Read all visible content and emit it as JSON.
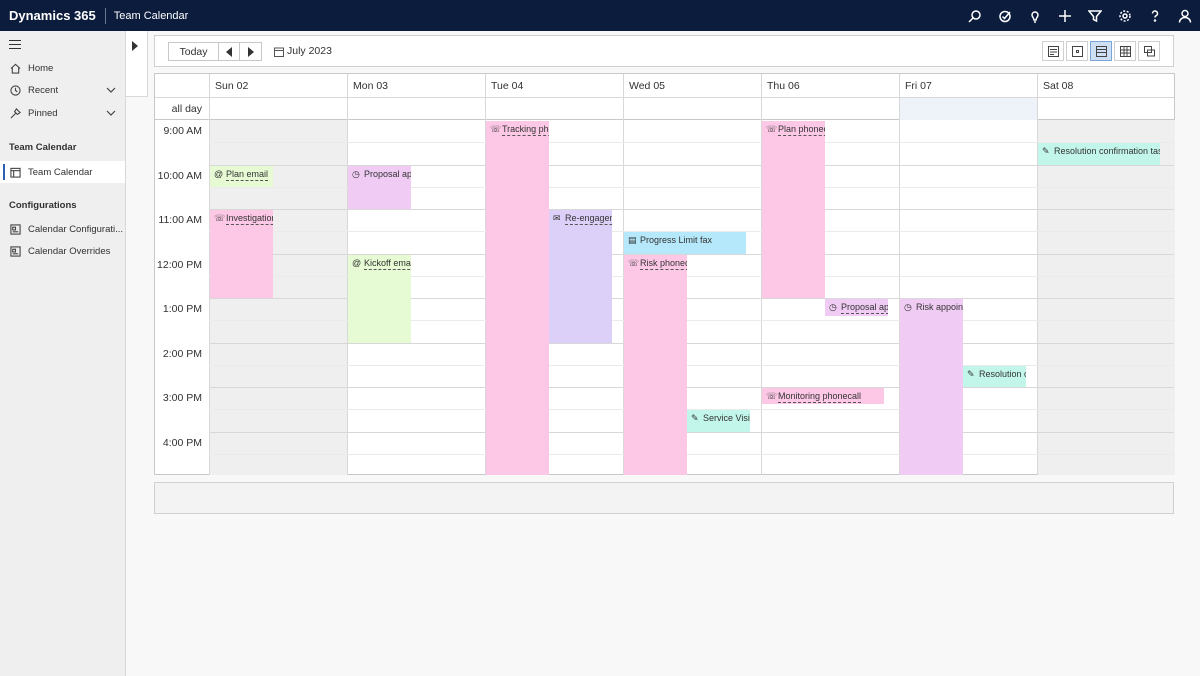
{
  "app": {
    "brand": "Dynamics 365",
    "title": "Team Calendar"
  },
  "topbar_icons": [
    "search-icon",
    "task-icon",
    "lightbulb-icon",
    "plus-icon",
    "filter-icon",
    "gear-icon",
    "help-icon",
    "user-icon"
  ],
  "sidebar": {
    "home": "Home",
    "recent": "Recent",
    "pinned": "Pinned",
    "section1": "Team Calendar",
    "team_calendar": "Team Calendar",
    "section2": "Configurations",
    "calendar_configuration": "Calendar Configurati...",
    "calendar_overrides": "Calendar Overrides"
  },
  "toolbar": {
    "today": "Today",
    "month": "July 2023"
  },
  "calendar": {
    "allday_label": "all day",
    "days": [
      "Sun 02",
      "Mon 03",
      "Tue 04",
      "Wed 05",
      "Thu 06",
      "Fri 07",
      "Sat 08"
    ],
    "times": [
      "9:00 AM",
      "10:00 AM",
      "11:00 AM",
      "12:00 PM",
      "1:00 PM",
      "2:00 PM",
      "3:00 PM",
      "4:00 PM"
    ],
    "events": [
      {
        "title": "Plan email",
        "day": 0,
        "start": 10.0,
        "end": 10.5,
        "sub": 0,
        "subs": 2,
        "color": "green",
        "icon": "@",
        "dashed": true
      },
      {
        "title": "Investigation phonecall",
        "day": 0,
        "start": 11.0,
        "end": 13.0,
        "sub": 0,
        "subs": 2,
        "color": "pink",
        "icon": "☏",
        "dashed": true
      },
      {
        "title": "Proposal appointment",
        "day": 1,
        "start": 10.0,
        "end": 11.0,
        "sub": 0,
        "subs": 2,
        "color": "violet",
        "icon": "◷",
        "dashed": false
      },
      {
        "title": "Kickoff email",
        "day": 1,
        "start": 12.0,
        "end": 14.0,
        "sub": 0,
        "subs": 2,
        "color": "green",
        "icon": "@",
        "dashed": true
      },
      {
        "title": "Tracking phonecall",
        "day": 2,
        "start": 9.0,
        "end": 17.0,
        "sub": 0,
        "subs": 2,
        "color": "pink",
        "icon": "☏",
        "dashed": true
      },
      {
        "title": "Re-engagement letter",
        "day": 2,
        "start": 11.0,
        "end": 14.0,
        "sub": 1,
        "subs": 2,
        "color": "lav",
        "icon": "✉",
        "dashed": true
      },
      {
        "title": "Progress Limit fax",
        "day": 3,
        "start": 11.5,
        "end": 12.0,
        "sub": 0,
        "subs": 1.1,
        "color": "blue",
        "icon": "▤",
        "dashed": false
      },
      {
        "title": "Risk phonecall",
        "day": 3,
        "start": 12.0,
        "end": 17.0,
        "sub": 0,
        "subs": 2,
        "color": "pink",
        "icon": "☏",
        "dashed": true
      },
      {
        "title": "Service Visit",
        "day": 3,
        "start": 15.5,
        "end": 16.0,
        "sub": 1,
        "subs": 2,
        "color": "teal",
        "icon": "✎",
        "dashed": false
      },
      {
        "title": "Plan phonecall",
        "day": 4,
        "start": 9.0,
        "end": 13.0,
        "sub": 0,
        "subs": 2,
        "color": "pink",
        "icon": "☏",
        "dashed": true
      },
      {
        "title": "Proposal appointment",
        "day": 4,
        "start": 13.0,
        "end": 13.4,
        "sub": 1,
        "subs": 2,
        "color": "violet",
        "icon": "◷",
        "dashed": true
      },
      {
        "title": "Monitoring phonecall",
        "day": 4,
        "start": 15.0,
        "end": 15.35,
        "sub": 0,
        "subs": 1.1,
        "color": "pink",
        "icon": "☏",
        "dashed": true
      },
      {
        "title": "Risk appointment",
        "day": 5,
        "start": 13.0,
        "end": 17.0,
        "sub": 0,
        "subs": 2,
        "color": "violet",
        "icon": "◷",
        "dashed": false
      },
      {
        "title": "Resolution confirmation task",
        "day": 5,
        "start": 14.5,
        "end": 15.0,
        "sub": 1,
        "subs": 2,
        "color": "teal",
        "icon": "✎",
        "dashed": false
      },
      {
        "title": "Resolution confirmation task",
        "day": 6,
        "start": 9.5,
        "end": 10.0,
        "sub": 0,
        "subs": 1.1,
        "color": "teal",
        "icon": "✎",
        "dashed": false
      }
    ]
  }
}
